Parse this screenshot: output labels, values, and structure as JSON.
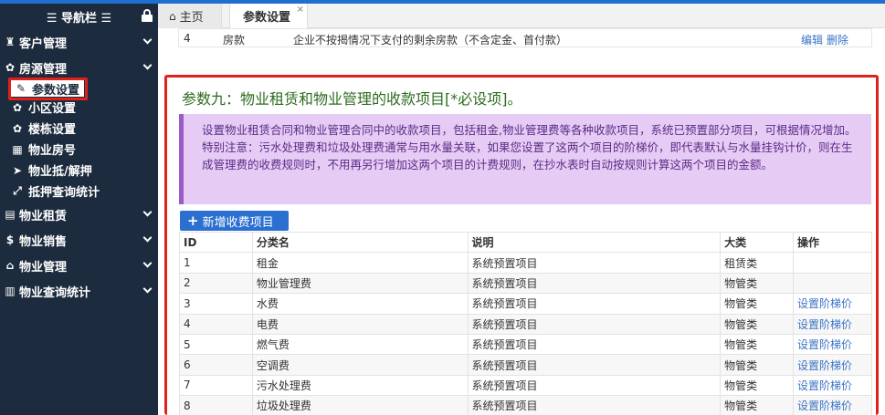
{
  "sidebar": {
    "title": "☰ 导航栏 ☰",
    "items": [
      {
        "icon": "customers-icon",
        "glyph": "♜",
        "label": "客户管理"
      },
      {
        "icon": "gear-icon",
        "glyph": "✿",
        "label": "房源管理"
      }
    ],
    "sub_items": [
      {
        "icon": "wrench-icon",
        "glyph": "✎",
        "label": "参数设置"
      },
      {
        "icon": "gear-icon",
        "glyph": "✿",
        "label": "小区设置"
      },
      {
        "icon": "gear-icon",
        "glyph": "✿",
        "label": "楼栋设置"
      },
      {
        "icon": "grid-icon",
        "glyph": "▦",
        "label": "物业房号"
      },
      {
        "icon": "tag-icon",
        "glyph": "➤",
        "label": "物业抵/解押"
      },
      {
        "icon": "expand-icon",
        "glyph": "⤢",
        "label": "抵押查询统计"
      }
    ],
    "bottom_items": [
      {
        "icon": "building-icon",
        "glyph": "▤",
        "label": "物业租赁"
      },
      {
        "icon": "dollar-icon",
        "glyph": "$",
        "label": "物业销售"
      },
      {
        "icon": "bank-icon",
        "glyph": "⌂",
        "label": "物业管理"
      },
      {
        "icon": "bar-chart-icon",
        "glyph": "▥",
        "label": "物业查询统计"
      }
    ]
  },
  "tabs": {
    "home": "主页",
    "param": "参数设置",
    "close": "×"
  },
  "prev_row": {
    "id": "4",
    "name": "房款",
    "desc": "企业不按揭情况下支付的剩余房款（不含定金、首付款）",
    "edit": "编辑",
    "delete": "删除"
  },
  "section": {
    "title": "参数九：物业租赁和物业管理的收款项目[*必设项]。",
    "notice": "设置物业租赁合同和物业管理合同中的收款项目，包括租金,物业管理费等各种收款项目，系统已预置部分项目，可根据情况增加。特别注意：污水处理费和垃圾处理费通常与用水量关联，如果您设置了这两个项目的阶梯价，即代表默认与水量挂钩计价，则在生成管理费的收费规则时，不用再另行增加这两个项目的计费规则，在抄水表时自动按规则计算这两个项目的金额。",
    "add_label": "新增收费项目"
  },
  "table": {
    "headers": [
      "ID",
      "分类名",
      "说明",
      "大类",
      "操作"
    ],
    "rows": [
      {
        "id": "1",
        "name": "租金",
        "desc": "系统预置项目",
        "cat": "租赁类",
        "op": ""
      },
      {
        "id": "2",
        "name": "物业管理费",
        "desc": "系统预置项目",
        "cat": "物管类",
        "op": ""
      },
      {
        "id": "3",
        "name": "水费",
        "desc": "系统预置项目",
        "cat": "物管类",
        "op": "设置阶梯价"
      },
      {
        "id": "4",
        "name": "电费",
        "desc": "系统预置项目",
        "cat": "物管类",
        "op": "设置阶梯价"
      },
      {
        "id": "5",
        "name": "燃气费",
        "desc": "系统预置项目",
        "cat": "物管类",
        "op": "设置阶梯价"
      },
      {
        "id": "6",
        "name": "空调费",
        "desc": "系统预置项目",
        "cat": "物管类",
        "op": "设置阶梯价"
      },
      {
        "id": "7",
        "name": "污水处理费",
        "desc": "系统预置项目",
        "cat": "物管类",
        "op": "设置阶梯价"
      },
      {
        "id": "8",
        "name": "垃圾处理费",
        "desc": "系统预置项目",
        "cat": "物管类",
        "op": "设置阶梯价"
      }
    ]
  }
}
